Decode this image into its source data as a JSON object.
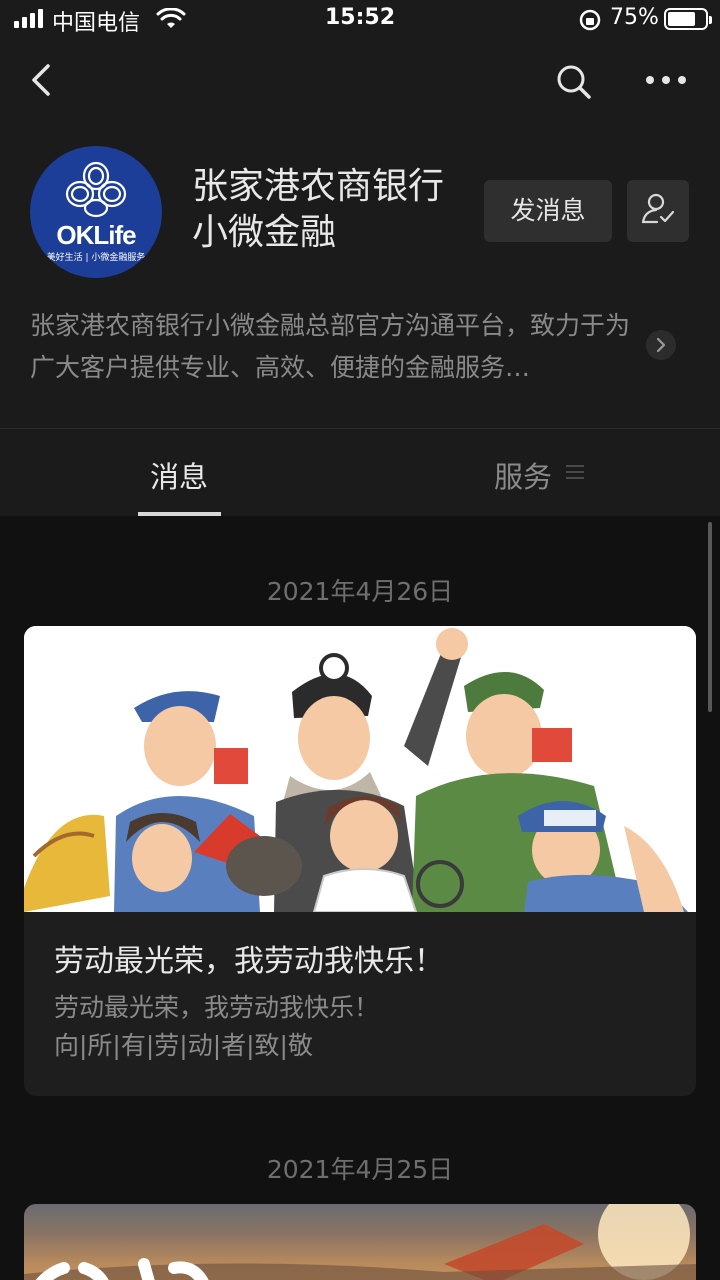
{
  "status_bar": {
    "carrier": "中国电信",
    "time": "15:52",
    "battery_percent": "75%",
    "battery_level": 0.75
  },
  "nav": {
    "back_icon": "chevron-left-icon",
    "search_icon": "search-icon",
    "more_icon": "more-dots-icon"
  },
  "profile": {
    "logo_text": "OKLife",
    "logo_tagline": "美好生活 | 小微金融服务",
    "name": "张家港农商银行小微金融",
    "message_button": "发消息",
    "follow_icon": "user-check-icon",
    "description": "张家港农商银行小微金融总部官方沟通平台，致力于为广大客户提供专业、高效、便捷的金融服务…",
    "brand_color": "#1d3e98"
  },
  "tabs": [
    {
      "label": "消息",
      "active": true
    },
    {
      "label": "服务",
      "active": false
    }
  ],
  "feed": [
    {
      "date": "2021年4月26日",
      "title": "劳动最光荣，我劳动我快乐！",
      "lines": [
        "劳动最光荣，我劳动我快乐！",
        "向|所|有|劳|动|者|致|敬"
      ]
    },
    {
      "date": "2021年4月25日"
    }
  ]
}
